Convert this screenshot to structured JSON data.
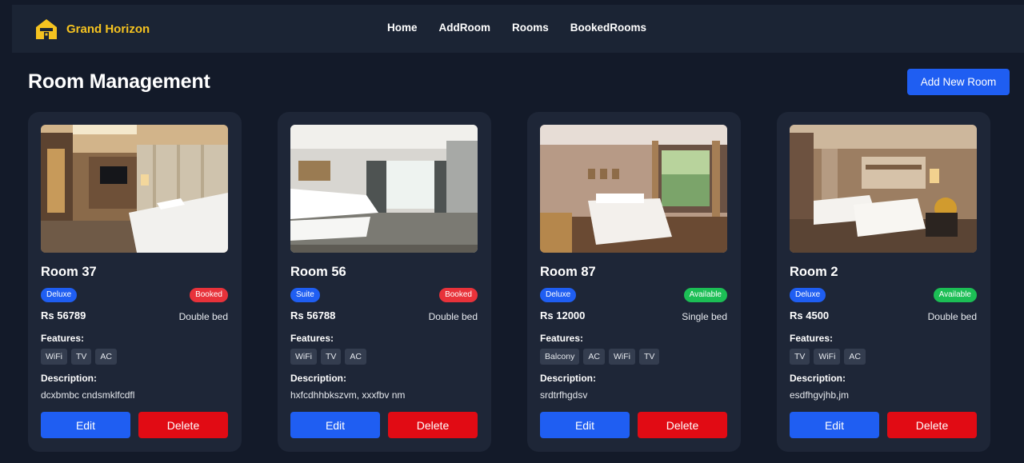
{
  "brand": {
    "name": "Grand Horizon",
    "icon": "house-icon",
    "color": "#f5c320"
  },
  "nav": [
    "Home",
    "AddRoom",
    "Rooms",
    "BookedRooms"
  ],
  "page": {
    "title": "Room Management",
    "add_button": "Add New Room"
  },
  "labels": {
    "features": "Features:",
    "description": "Description:",
    "edit": "Edit",
    "delete": "Delete"
  },
  "colors": {
    "primary": "#1f5ef2",
    "danger": "#e10b14",
    "booked": "#e8323a",
    "available": "#1cbe55"
  },
  "rooms": [
    {
      "name": "Room 37",
      "type": "Deluxe",
      "status": "Booked",
      "price": "Rs 56789",
      "bed": "Double bed",
      "features": [
        "WiFi",
        "TV",
        "AC"
      ],
      "description": "dcxbmbc cndsmklfcdfl"
    },
    {
      "name": "Room 56",
      "type": "Suite",
      "status": "Booked",
      "price": "Rs 56788",
      "bed": "Double bed",
      "features": [
        "WiFi",
        "TV",
        "AC"
      ],
      "description": "hxfcdhhbkszvm, xxxfbv nm"
    },
    {
      "name": "Room 87",
      "type": "Deluxe",
      "status": "Available",
      "price": "Rs 12000",
      "bed": "Single bed",
      "features": [
        "Balcony",
        "AC",
        "WiFi",
        "TV"
      ],
      "description": "srdtrfhgdsv"
    },
    {
      "name": "Room 2",
      "type": "Deluxe",
      "status": "Available",
      "price": "Rs 4500",
      "bed": "Double bed",
      "features": [
        "TV",
        "WiFi",
        "AC"
      ],
      "description": "esdfhgvjhb,jm"
    }
  ]
}
